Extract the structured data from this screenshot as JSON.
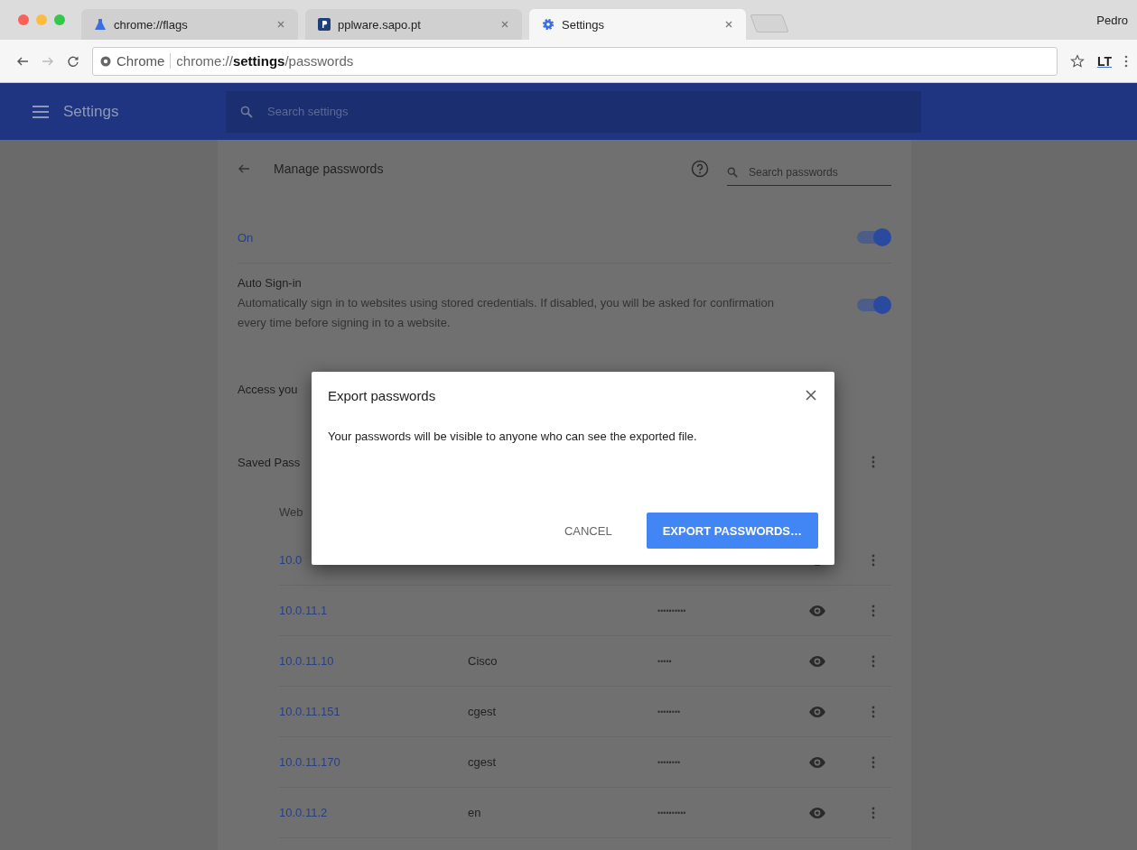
{
  "browser": {
    "tabs": [
      {
        "title": "chrome://flags",
        "kind": "flask",
        "selected": false
      },
      {
        "title": "pplware.sapo.pt",
        "kind": "letter",
        "selected": false
      },
      {
        "title": "Settings",
        "kind": "gear",
        "selected": true
      }
    ],
    "profile": "Pedro",
    "address": {
      "origin": "Chrome",
      "url": "chrome://**settings**/passwords"
    },
    "extension": "LT"
  },
  "header": {
    "title": "Settings",
    "search_placeholder": "Search settings"
  },
  "page": {
    "title": "Manage passwords",
    "search_placeholder": "Search passwords",
    "save_passwords": {
      "label": "On",
      "on": true
    },
    "auto_signin": {
      "title": "Auto Sign-in",
      "description": "Automatically sign in to websites using stored credentials. If disabled, you will be asked for confirmation every time before signing in to a website.",
      "on": true
    },
    "access_text": "Access you",
    "saved_heading": "Saved Pass",
    "column_header": "Web",
    "rows": [
      {
        "site": "10.0"
      },
      {
        "site": "10.0.11.1",
        "password": "••••••••••"
      },
      {
        "site": "10.0.11.10",
        "username": "Cisco",
        "password": "•••••"
      },
      {
        "site": "10.0.11.151",
        "username": "cgest",
        "password": "••••••••"
      },
      {
        "site": "10.0.11.170",
        "username": "cgest",
        "password": "••••••••"
      },
      {
        "site": "10.0.11.2",
        "username": "en",
        "password": "••••••••••"
      }
    ]
  },
  "dialog": {
    "title": "Export passwords",
    "message": "Your passwords will be visible to anyone who can see the exported file.",
    "buttons": [
      {
        "label": "CANCEL",
        "kind": "text"
      },
      {
        "label": "EXPORT PASSWORDS…",
        "kind": "primary"
      }
    ]
  }
}
